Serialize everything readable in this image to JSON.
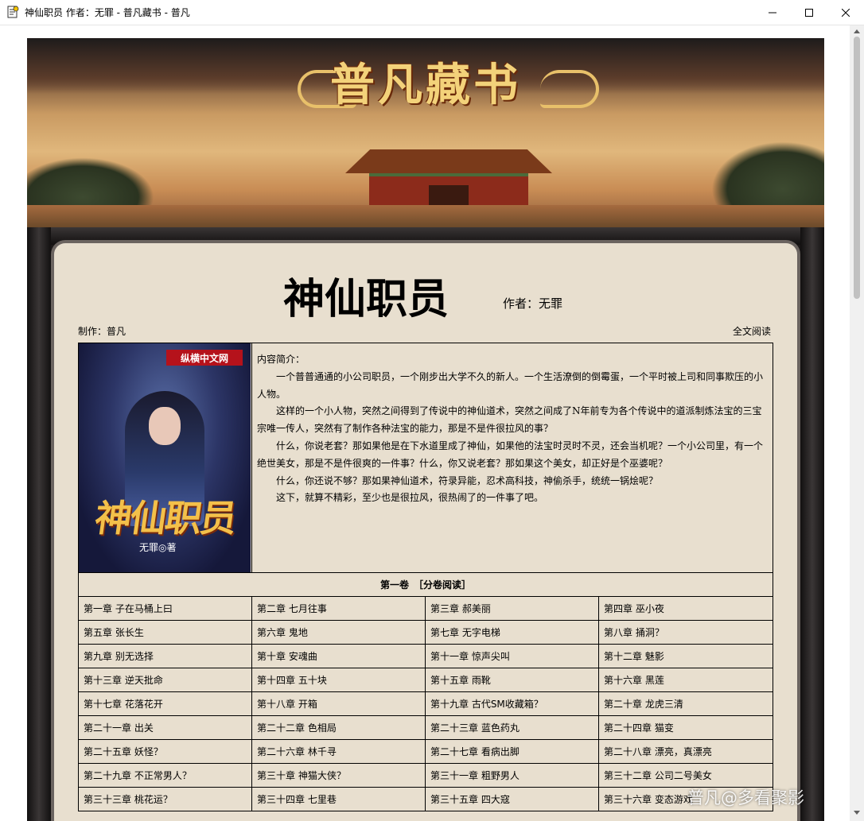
{
  "window": {
    "title": "神仙职员 作者：无罪 - 普凡藏书 - 普凡",
    "controls": [
      "minimize",
      "maximize",
      "close"
    ]
  },
  "banner": {
    "title": "普凡藏书"
  },
  "book": {
    "title": "神仙职员",
    "author_label": "作者：无罪",
    "maker_label": "制作：普凡",
    "full_read_link": "全文阅读"
  },
  "cover": {
    "badge": "纵横中文网",
    "title": "神仙职员",
    "author": "无罪◎著"
  },
  "intro": {
    "heading": "内容简介：",
    "paragraphs": [
      "一个普普通通的小公司职员，一个刚步出大学不久的新人。一个生活潦倒的倒霉蛋，一个平时被上司和同事欺压的小人物。",
      "这样的一个小人物，突然之间得到了传说中的神仙道术，突然之间成了N年前专为各个传说中的道派制炼法宝的三宝宗唯一传人，突然有了制作各种法宝的能力，那是不是件很拉风的事？",
      "什么，你说老套？那如果他是在下水道里成了神仙，如果他的法宝时灵时不灵，还会当机呢？一个小公司里，有一个绝世美女，那是不是件很爽的一件事？什么，你又说老套？那如果这个美女，却正好是个巫婆呢？",
      "什么，你还说不够？那如果神仙道术，符录异能，忍术高科技，神偷杀手，统统一锅烩呢？",
      "这下，就算不精彩，至少也是很拉风，很热闹了的一件事了吧。"
    ]
  },
  "volume": {
    "title": "第一卷　［分卷阅读］"
  },
  "chapters": [
    [
      "第一章 子在马桶上曰",
      "第二章 七月往事",
      "第三章 郝美丽",
      "第四章 巫小夜"
    ],
    [
      "第五章 张长生",
      "第六章 鬼地",
      "第七章 无字电梯",
      "第八章 捅洞？"
    ],
    [
      "第九章 别无选择",
      "第十章 安魂曲",
      "第十一章 惊声尖叫",
      "第十二章 魅影"
    ],
    [
      "第十三章 逆天批命",
      "第十四章 五十块",
      "第十五章 雨靴",
      "第十六章 黑莲"
    ],
    [
      "第十七章 花落花开",
      "第十八章 开箱",
      "第十九章 古代SM收藏箱？",
      "第二十章 龙虎三清"
    ],
    [
      "第二十一章 出关",
      "第二十二章 色相局",
      "第二十三章 蓝色药丸",
      "第二十四章 猫变"
    ],
    [
      "第二十五章 妖怪？",
      "第二十六章 林千寻",
      "第二十七章 看病出脚",
      "第二十八章 漂亮，真漂亮"
    ],
    [
      "第二十九章 不正常男人？",
      "第三十章 神猫大侠？",
      "第三十一章 粗野男人",
      "第三十二章 公司二号美女"
    ],
    [
      "第三十三章 桃花运？",
      "第三十四章 七里巷",
      "第三十五章 四大寇",
      "第三十六章 变态游戏"
    ]
  ],
  "watermark": "普凡@多看聚影"
}
